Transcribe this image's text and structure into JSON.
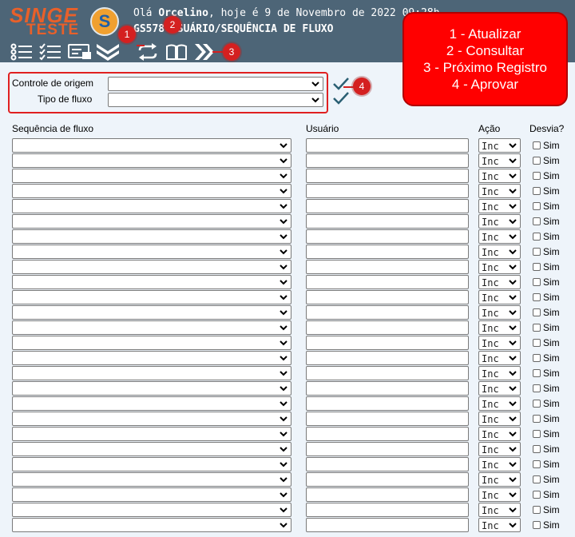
{
  "header": {
    "logo_top": "SINGE",
    "logo_bottom": "TESTE",
    "logo_mark": "S",
    "greeting_prefix": "Olá ",
    "user_name": "Orcelino",
    "greeting_suffix": ", hoje é 9 de Novembro de 2022 09:28h",
    "screen_title": "GS578 USUÁRIO/SEQUÊNCIA DE FLUXO"
  },
  "toolbar": {
    "icons": [
      "list-icon",
      "checklist-icon",
      "card-icon",
      "double-chevron-down-icon",
      "refresh-icon",
      "book-icon",
      "double-chevron-right-icon"
    ]
  },
  "filters": {
    "origin_label": "Controle de origem",
    "flow_type_label": "Tipo de fluxo"
  },
  "table": {
    "col_sequence": "Sequência de fluxo",
    "col_user": "Usuário",
    "col_action": "Ação",
    "col_deviate": "Desvia?",
    "action_value": "Inc",
    "checkbox_label": "Sim",
    "row_count": 26
  },
  "badges": [
    "1",
    "2",
    "3",
    "4"
  ],
  "callout": {
    "line1": "1 - Atualizar",
    "line2": "2 - Consultar",
    "line3": "3 - Próximo Registro",
    "line4": "4 - Aprovar"
  },
  "colors": {
    "header_bg": "#4d6577",
    "content_bg": "#eef4fa",
    "logo_orange": "#e8602a",
    "annotation_red": "#d42020",
    "check_teal": "#2a5f73"
  }
}
